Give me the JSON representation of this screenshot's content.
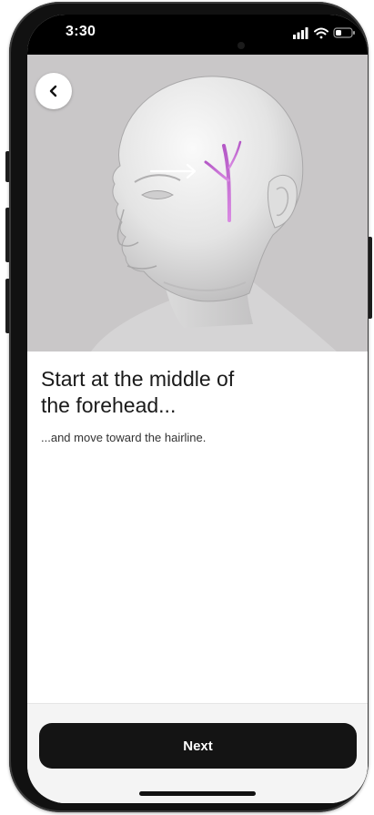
{
  "status_bar": {
    "time": "3:30",
    "icons": [
      "signal-icon",
      "wifi-icon",
      "battery-icon"
    ]
  },
  "hero": {
    "image_icon": "head-forehead-illustration",
    "arrow_icon": "arrow-right-icon",
    "highlight_color": "#c05cd1"
  },
  "navigation": {
    "back_icon": "chevron-left-icon"
  },
  "content": {
    "headline_line1": "Start at the middle of",
    "headline_line2": "the forehead...",
    "subtext": "...and move toward the hairline."
  },
  "footer": {
    "next_label": "Next"
  },
  "colors": {
    "button_bg": "#141414",
    "button_text": "#ffffff",
    "hero_bg": "#c9c7c8",
    "accent_vein": "#c05cd1"
  }
}
